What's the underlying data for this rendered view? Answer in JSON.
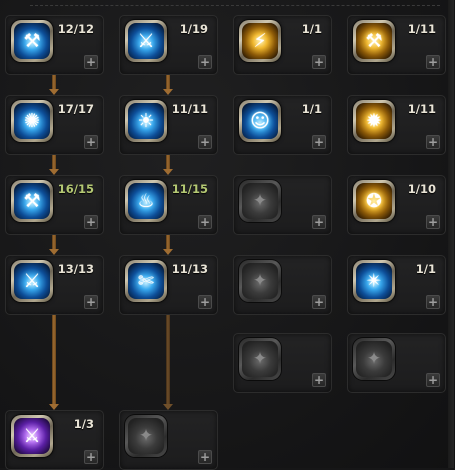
{
  "skill_tree": {
    "nodes": [
      {
        "id": "r1c1",
        "count": "12/12",
        "state": "skill",
        "color": "blue",
        "icon": "hammer-pillar-icon",
        "glyph": "⚒"
      },
      {
        "id": "r1c2",
        "count": "1/19",
        "state": "skill",
        "color": "blue",
        "icon": "axe-icon",
        "glyph": "⚔"
      },
      {
        "id": "r1c3",
        "count": "1/1",
        "state": "skill",
        "color": "gold",
        "icon": "lightning-crown-icon",
        "glyph": "⚡"
      },
      {
        "id": "r1c4",
        "count": "1/11",
        "state": "skill",
        "color": "gold",
        "icon": "hammer-strike-icon",
        "glyph": "⚒"
      },
      {
        "id": "r2c1",
        "count": "17/17",
        "state": "skill",
        "color": "blue",
        "icon": "whirlwind-icon",
        "glyph": "✺"
      },
      {
        "id": "r2c2",
        "count": "11/11",
        "state": "skill",
        "color": "blue",
        "icon": "bell-shield-icon",
        "glyph": "☀"
      },
      {
        "id": "r2c3",
        "count": "1/1",
        "state": "skill",
        "color": "blue",
        "icon": "roaring-face-icon",
        "glyph": "☺"
      },
      {
        "id": "r2c4",
        "count": "1/11",
        "state": "skill",
        "color": "gold",
        "icon": "shouting-face-icon",
        "glyph": "✹"
      },
      {
        "id": "r3c1",
        "count": "16/15",
        "state": "skill",
        "color": "blue",
        "icon": "hammer-smash-icon",
        "glyph": "⚒",
        "over": true
      },
      {
        "id": "r3c2",
        "count": "11/15",
        "state": "skill",
        "color": "blue",
        "icon": "flame-pillar-icon",
        "glyph": "♨",
        "over": true
      },
      {
        "id": "r3c3",
        "count": "",
        "state": "locked",
        "color": "gray",
        "icon": "locked-skill-icon",
        "glyph": "✦"
      },
      {
        "id": "r3c4",
        "count": "1/10",
        "state": "skill",
        "color": "gold",
        "icon": "golden-swirl-icon",
        "glyph": "✪"
      },
      {
        "id": "r4c1",
        "count": "13/13",
        "state": "skill",
        "color": "blue",
        "icon": "winged-axe-icon",
        "glyph": "⚔"
      },
      {
        "id": "r4c2",
        "count": "11/13",
        "state": "skill",
        "color": "blue",
        "icon": "slash-strike-icon",
        "glyph": "✄"
      },
      {
        "id": "r4c3",
        "count": "",
        "state": "locked",
        "color": "gray",
        "icon": "locked-skill-icon",
        "glyph": "✦"
      },
      {
        "id": "r4c4",
        "count": "1/1",
        "state": "skill",
        "color": "blue",
        "icon": "radiant-burst-icon",
        "glyph": "✴"
      },
      {
        "id": "r5c3",
        "count": "",
        "state": "locked",
        "color": "gray",
        "icon": "locked-skill-icon",
        "glyph": "✦"
      },
      {
        "id": "r5c4",
        "count": "",
        "state": "locked",
        "color": "gray",
        "icon": "locked-skill-icon",
        "glyph": "✦"
      },
      {
        "id": "r6c1",
        "count": "1/3",
        "state": "skill",
        "color": "purple",
        "icon": "purple-axe-icon",
        "glyph": "⚔"
      },
      {
        "id": "r6c2",
        "count": "",
        "state": "locked",
        "color": "gray",
        "icon": "locked-skill-icon",
        "glyph": "✦"
      }
    ],
    "plus_label": "+",
    "colors": {
      "count_normal": "#e9e4d6",
      "count_over": "#b4c873",
      "connector": "#a06d32"
    }
  }
}
